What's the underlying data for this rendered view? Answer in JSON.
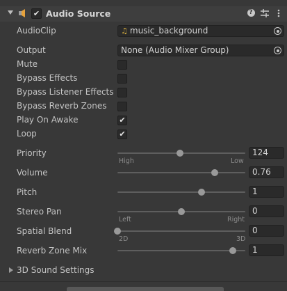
{
  "header": {
    "title": "Audio Source",
    "enabled": true,
    "help_icon": "help-icon",
    "preset_icon": "preset-icon",
    "menu_icon": "menu-icon"
  },
  "fields": {
    "audioclip": {
      "label": "AudioClip",
      "value": "music_background",
      "icon": "music-note-icon"
    },
    "output": {
      "label": "Output",
      "value": "None (Audio Mixer Group)"
    }
  },
  "toggles": [
    {
      "label": "Mute",
      "checked": false
    },
    {
      "label": "Bypass Effects",
      "checked": false
    },
    {
      "label": "Bypass Listener Effects",
      "checked": false
    },
    {
      "label": "Bypass Reverb Zones",
      "checked": false
    },
    {
      "label": "Play On Awake",
      "checked": true
    },
    {
      "label": "Loop",
      "checked": true
    }
  ],
  "sliders": [
    {
      "label": "Priority",
      "value": "124",
      "fraction": 0.49,
      "left_hint": "High",
      "right_hint": "Low"
    },
    {
      "label": "Volume",
      "value": "0.76",
      "fraction": 0.76
    },
    {
      "label": "Pitch",
      "value": "1",
      "fraction": 0.66
    },
    {
      "label": "Stereo Pan",
      "value": "0",
      "fraction": 0.5,
      "left_hint": "Left",
      "right_hint": "Right"
    },
    {
      "label": "Spatial Blend",
      "value": "0",
      "fraction": 0.0,
      "left_hint": "2D",
      "right_hint": "3D"
    },
    {
      "label": "Reverb Zone Mix",
      "value": "1",
      "fraction": 0.9
    }
  ],
  "sound3d": {
    "label": "3D Sound Settings"
  },
  "check_glyph": "✔",
  "colors": {
    "background": "#383838",
    "header": "#3e3e3e",
    "field": "#2a2a2a",
    "accent_note": "#e0b640"
  }
}
